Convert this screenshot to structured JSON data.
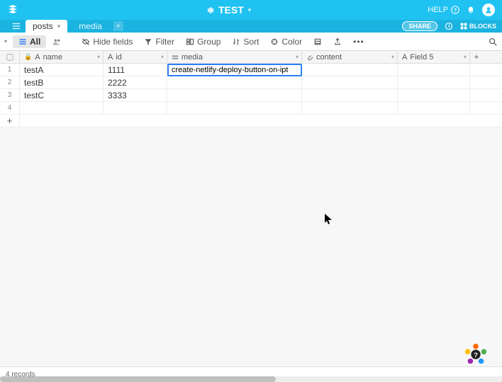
{
  "header": {
    "base_name": "TEST",
    "help_label": "HELP",
    "share_label": "SHARE",
    "blocks_label": "BLOCKS"
  },
  "tabs": [
    {
      "label": "posts",
      "active": true
    },
    {
      "label": "media",
      "active": false
    }
  ],
  "view": {
    "name": "All",
    "tools": {
      "hide_fields": "Hide fields",
      "filter": "Filter",
      "group": "Group",
      "sort": "Sort",
      "color": "Color"
    }
  },
  "columns": [
    {
      "key": "name",
      "label": "name",
      "icon": "text"
    },
    {
      "key": "id",
      "label": "id",
      "icon": "text"
    },
    {
      "key": "media",
      "label": "media",
      "icon": "multi"
    },
    {
      "key": "content",
      "label": "content",
      "icon": "attach"
    },
    {
      "key": "field5",
      "label": "Field 5",
      "icon": "text"
    }
  ],
  "rows": [
    {
      "num": "1",
      "name": "testA",
      "id": "1111",
      "media": "create-netlify-deploy-button-on-ipt",
      "content": "",
      "f5": "",
      "active": true
    },
    {
      "num": "2",
      "name": "testB",
      "id": "2222",
      "media": "",
      "content": "",
      "f5": ""
    },
    {
      "num": "3",
      "name": "testC",
      "id": "3333",
      "media": "",
      "content": "",
      "f5": ""
    },
    {
      "num": "4",
      "name": "",
      "id": "",
      "media": "",
      "content": "",
      "f5": ""
    }
  ],
  "footer": {
    "records": "4 records"
  }
}
